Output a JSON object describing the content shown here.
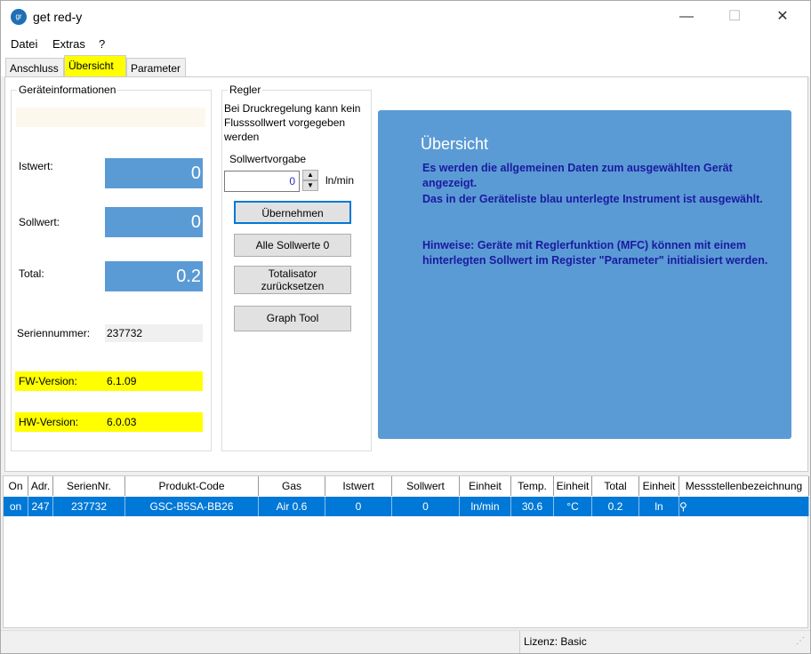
{
  "window": {
    "title": "get red-y",
    "logo_text": "gr",
    "minimize": "—",
    "maximize": "☐",
    "close": "✕"
  },
  "menu": [
    "Datei",
    "Extras",
    "?"
  ],
  "tabs": [
    "Anschluss",
    "Übersicht",
    "Parameter"
  ],
  "device_info": {
    "title": "Geräteinformationen",
    "istwert_label": "Istwert:",
    "istwert": "0",
    "sollwert_label": "Sollwert:",
    "sollwert": "0",
    "total_label": "Total:",
    "total": "0.2",
    "serial_label": "Seriennummer:",
    "serial": "237732",
    "fw_label": "FW-Version:",
    "fw": "6.1.09",
    "hw_label": "HW-Version:",
    "hw": "6.0.03"
  },
  "regler": {
    "title": "Regler",
    "note": "Bei Druckregelung kann kein Flusssollwert vorgegeben werden",
    "setpoint_label": "Sollwertvorgabe",
    "setpoint_value": "0",
    "unit": "ln/min",
    "btn_apply": "Übernehmen",
    "btn_all_zero": "Alle Sollwerte 0",
    "btn_reset_total": "Totalisator zurücksetzen",
    "btn_graph": "Graph Tool"
  },
  "overview": {
    "heading": "Übersicht",
    "text1": "Es werden die allgemeinen Daten zum ausgewählten Gerät angezeigt.",
    "text2": "Das in der Geräteliste blau unterlegte Instrument ist ausgewählt.",
    "text3": "Hinweise: Geräte mit Reglerfunktion (MFC) können mit einem hinterlegten Sollwert im Register \"Parameter\" initialisiert werden."
  },
  "table": {
    "columns": [
      "On",
      "Adr.",
      "SerienNr.",
      "Produkt-Code",
      "Gas",
      "Istwert",
      "Sollwert",
      "Einheit",
      "Temp.",
      "Einheit",
      "Total",
      "Einheit",
      "Messstellenbezeichnung"
    ],
    "rows": [
      [
        "on",
        "247",
        "237732",
        "GSC-B5SA-BB26",
        "Air 0.6",
        "0",
        "0",
        "ln/min",
        "30.6",
        "°C",
        "0.2",
        "ln",
        ""
      ]
    ]
  },
  "status": {
    "license": "Lizenz: Basic"
  },
  "colors": {
    "accent_blue": "#5b9bd5",
    "selection": "#0078d7",
    "highlight": "#ffff00"
  }
}
